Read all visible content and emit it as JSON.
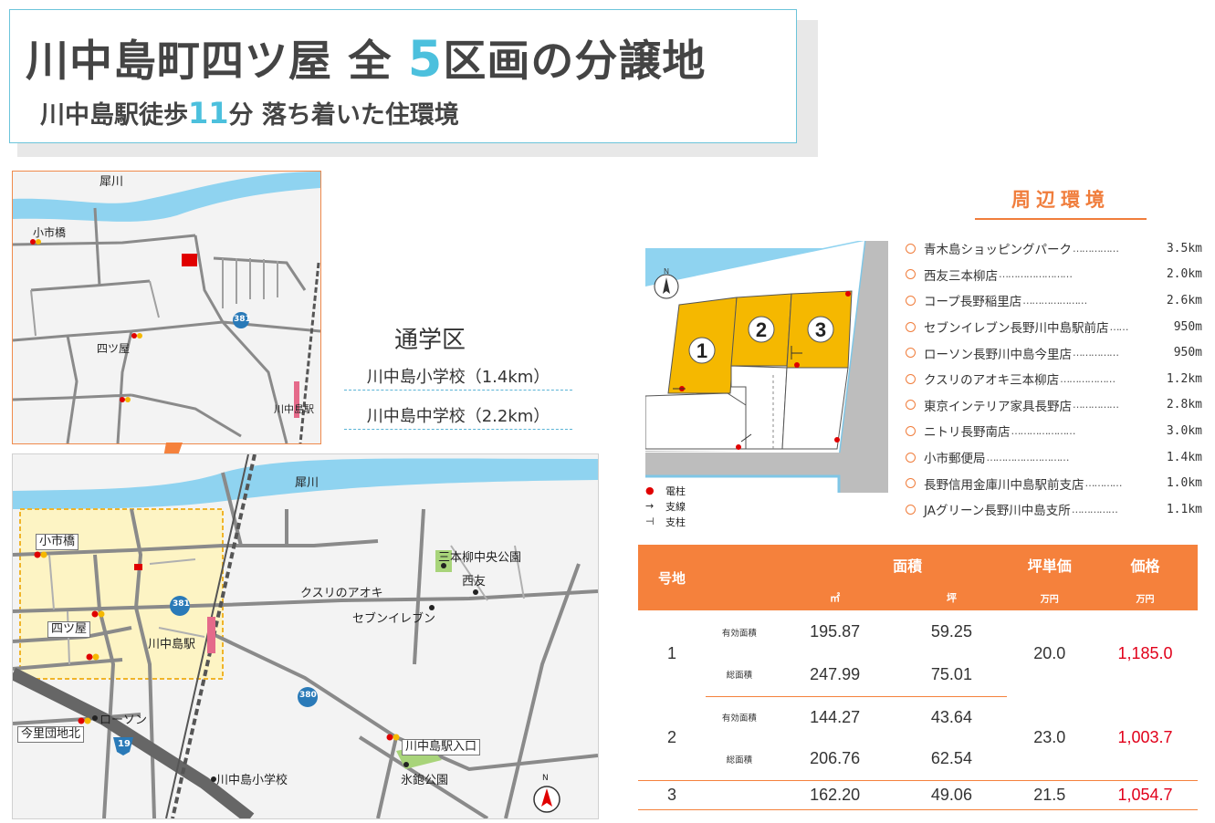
{
  "header": {
    "title_pre": "川中島町四ツ屋 全",
    "title_num": "5",
    "title_post": "区画の分譲地",
    "subtitle_pre": "川中島駅徒歩",
    "subtitle_num": "11",
    "subtitle_post": "分 落ち着いた住環境"
  },
  "map_small": {
    "labels": {
      "river": "犀川",
      "kobashi": "小市橋",
      "yotsuya": "四ツ屋",
      "station": "川中島駅",
      "route": "381"
    }
  },
  "map_large": {
    "labels": {
      "river": "犀川",
      "kobashi": "小市橋",
      "yotsuya": "四ツ屋",
      "station": "川中島駅",
      "route381": "381",
      "route380": "380",
      "route19": "19",
      "kusuri": "クスリのアオキ",
      "park1": "三本柳中央公園",
      "nishitomo": "西友",
      "seven": "セブンイレブン",
      "lawson": "ローソン",
      "imazato": "今里団地北",
      "school": "川中島小学校",
      "station_entrance": "川中島駅入口",
      "park2": "氷鉋公園",
      "north": "N"
    }
  },
  "school": {
    "title": "通学区",
    "elementary": "川中島小学校（1.4km）",
    "junior": "川中島中学校（2.2km）"
  },
  "environment": {
    "title": "周辺環境",
    "items": [
      {
        "name": "青木島ショッピングパーク",
        "dots": "……………",
        "distance": "3.5km"
      },
      {
        "name": "西友三本柳店",
        "dots": "……………………",
        "distance": "2.0km"
      },
      {
        "name": "コープ長野稲里店",
        "dots": "…………………",
        "distance": "2.6km"
      },
      {
        "name": "セブンイレブン長野川中島駅前店",
        "dots": "……",
        "distance": "950m"
      },
      {
        "name": "ローソン長野川中島今里店",
        "dots": "……………",
        "distance": "950m"
      },
      {
        "name": "クスリのアオキ三本柳店",
        "dots": "………………",
        "distance": "1.2km"
      },
      {
        "name": "東京インテリア家具長野店",
        "dots": "……………",
        "distance": "2.8km"
      },
      {
        "name": "ニトリ長野南店",
        "dots": "…………………",
        "distance": "3.0km"
      },
      {
        "name": "小市郵便局",
        "dots": "………………………",
        "distance": "1.4km"
      },
      {
        "name": "長野信用金庫川中島駅前支店",
        "dots": "…………",
        "distance": "1.0km"
      },
      {
        "name": "JAグリーン長野川中島支所",
        "dots": "……………",
        "distance": "1.1km"
      }
    ]
  },
  "plot": {
    "north": "N",
    "lots": [
      "1",
      "2",
      "3"
    ],
    "legend": [
      {
        "symbol": "●",
        "label": "電柱"
      },
      {
        "symbol": "→",
        "label": "支線"
      },
      {
        "symbol": "⊣",
        "label": "支柱"
      }
    ],
    "colors": {
      "lot": "#f5b800",
      "water": "#8fd3f0",
      "road": "#bdbdbd"
    }
  },
  "table": {
    "headers": {
      "lot": "号地",
      "area": "面積",
      "unit_price": "坪単価",
      "price": "価格"
    },
    "subheaders": {
      "sqm": "㎡",
      "tsubo": "坪",
      "unit_price_unit": "万円",
      "price_unit": "万円"
    },
    "row_labels": {
      "effective": "有効面積",
      "total": "総面積"
    },
    "rows": [
      {
        "lot": "1",
        "eff_sqm": "195.87",
        "eff_tsubo": "59.25",
        "tot_sqm": "247.99",
        "tot_tsubo": "75.01",
        "unit_price": "20.0",
        "price": "1,185.0"
      },
      {
        "lot": "2",
        "eff_sqm": "144.27",
        "eff_tsubo": "43.64",
        "tot_sqm": "206.76",
        "tot_tsubo": "62.54",
        "unit_price": "23.0",
        "price": "1,003.7"
      },
      {
        "lot": "3",
        "sqm": "162.20",
        "tsubo": "49.06",
        "unit_price": "21.5",
        "price": "1,054.7"
      }
    ],
    "colors": {
      "header": "#f5813c",
      "price": "#e1001a"
    }
  }
}
